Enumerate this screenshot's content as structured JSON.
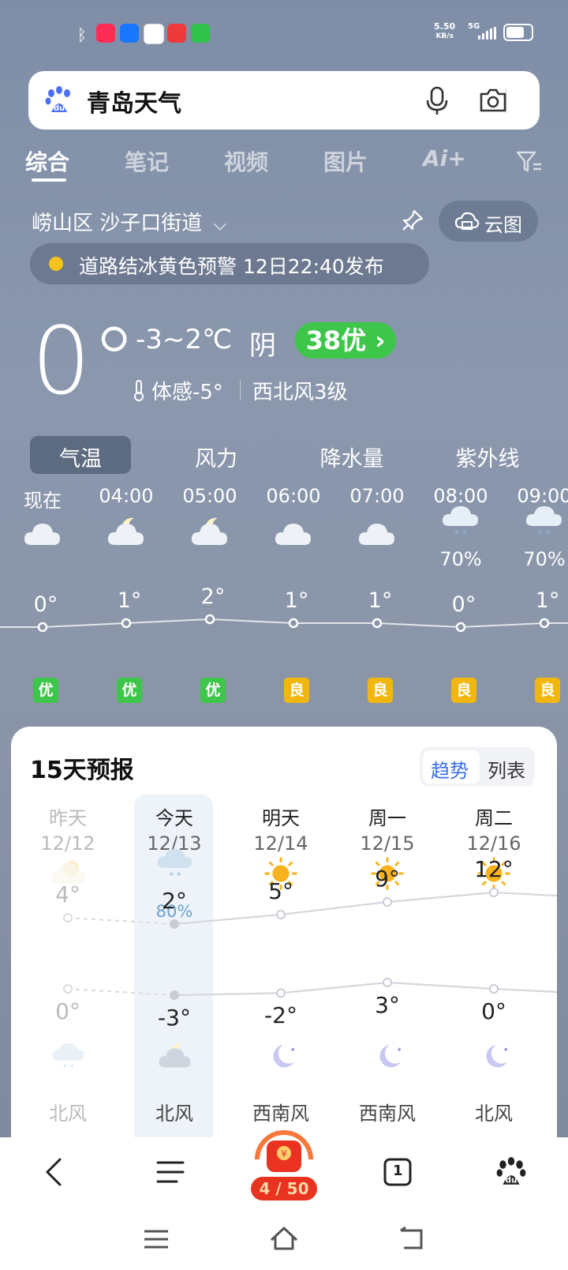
{
  "status_bar": {
    "speed_value": "5.50",
    "speed_unit": "KB/s",
    "network": "5G"
  },
  "search": {
    "query": "青岛天气"
  },
  "tabs": [
    {
      "label": "综合"
    },
    {
      "label": "笔记"
    },
    {
      "label": "视频"
    },
    {
      "label": "图片"
    },
    {
      "label": "Ai+"
    }
  ],
  "location": {
    "name": "崂山区 沙子口街道",
    "cloud_button": "云图"
  },
  "alert": {
    "text": "道路结冰黄色预警 12日22:40发布",
    "color": "#f6c21b"
  },
  "current": {
    "temp": "0°",
    "range": "-3~2℃",
    "condition": "阴",
    "aqi": "38优",
    "feels_like": "体感-5°",
    "wind": "西北风3级"
  },
  "segments": [
    "气温",
    "风力",
    "降水量",
    "紫外线"
  ],
  "hourly": [
    {
      "time": "现在",
      "icon": "cloud-icon",
      "precip": "",
      "temp": "0°",
      "aq": "优"
    },
    {
      "time": "04:00",
      "icon": "moon-cloud-icon",
      "precip": "",
      "temp": "1°",
      "aq": "优"
    },
    {
      "time": "05:00",
      "icon": "moon-cloud-icon",
      "precip": "",
      "temp": "2°",
      "aq": "优"
    },
    {
      "time": "06:00",
      "icon": "cloud-icon",
      "precip": "",
      "temp": "1°",
      "aq": "良"
    },
    {
      "time": "07:00",
      "icon": "cloud-icon",
      "precip": "",
      "temp": "1°",
      "aq": "良"
    },
    {
      "time": "08:00",
      "icon": "snow-cloud-icon",
      "precip": "70%",
      "temp": "0°",
      "aq": "良"
    },
    {
      "time": "09:00",
      "icon": "snow-cloud-icon",
      "precip": "70%",
      "temp": "1°",
      "aq": "良"
    }
  ],
  "aq_colors": {
    "优": "#3ec64a",
    "良": "#f2b70f"
  },
  "forecast": {
    "title": "15天预报",
    "toggle_trend": "趋势",
    "toggle_list": "列表",
    "days": [
      {
        "name": "昨天",
        "date": "12/12",
        "icon": "sun-cloud-icon",
        "precip": "",
        "high": "4°",
        "low": "0°",
        "night_icon": "snow-cloud-icon",
        "wind": "北风"
      },
      {
        "name": "今天",
        "date": "12/13",
        "icon": "snow-cloud-icon",
        "precip": "80%",
        "high": "2°",
        "low": "-3°",
        "night_icon": "moon-cloud-icon",
        "wind": "北风"
      },
      {
        "name": "明天",
        "date": "12/14",
        "icon": "sun-icon",
        "precip": "",
        "high": "5°",
        "low": "-2°",
        "night_icon": "moon-icon",
        "wind": "西南风"
      },
      {
        "name": "周一",
        "date": "12/15",
        "icon": "sun-icon",
        "precip": "",
        "high": "9°",
        "low": "3°",
        "night_icon": "moon-icon",
        "wind": "西南风"
      },
      {
        "name": "周二",
        "date": "12/16",
        "icon": "sun-icon",
        "precip": "",
        "high": "12°",
        "low": "0°",
        "night_icon": "moon-icon",
        "wind": "北风"
      }
    ]
  },
  "bottom_nav": {
    "counter": "4 / 50",
    "tab_count": "1"
  }
}
